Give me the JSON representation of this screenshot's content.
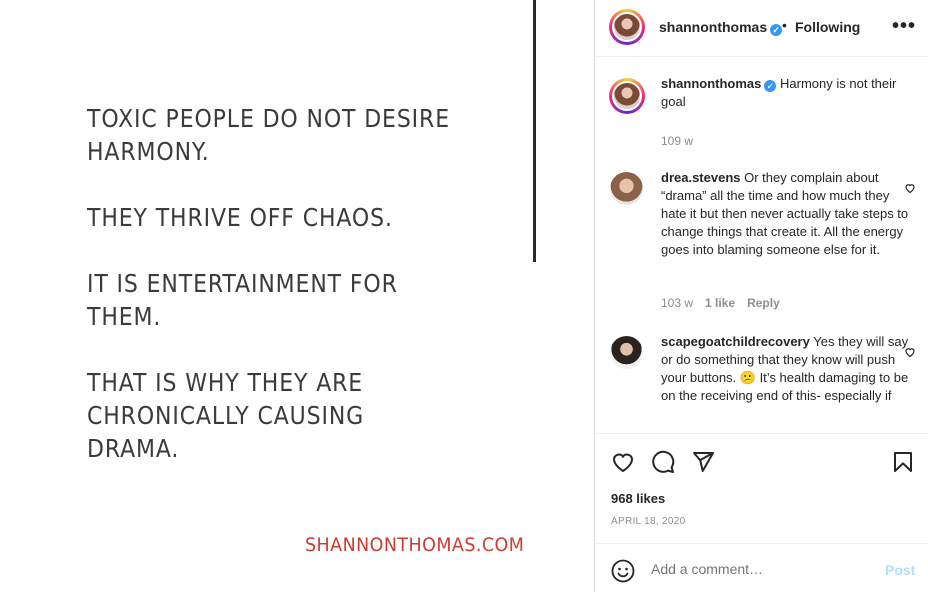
{
  "post_image": {
    "quote_lines": [
      "TOXIC PEOPLE DO NOT DESIRE\nHARMONY.",
      "THEY THRIVE OFF CHAOS.",
      "IT IS ENTERTAINMENT FOR\nTHEM.",
      "THAT IS WHY THEY ARE\nCHRONICALLY CAUSING\nDRAMA."
    ],
    "website": "SHANNONTHOMAS.COM",
    "website_color": "#cc3b2f"
  },
  "header": {
    "username": "shannonthomas",
    "verified_icon": "verified-badge-icon",
    "separator": "•",
    "follow_state": "Following",
    "more_icon": "more-options-icon"
  },
  "caption": {
    "username": "shannonthomas",
    "text": "Harmony is not their goal",
    "age": "109 w"
  },
  "comments": [
    {
      "username": "drea.stevens",
      "text": "Or they complain about “drama” all the time and how much they hate it but then never actually take steps to change things that create it. All the energy goes into blaming someone else for it.",
      "age": "103 w",
      "likes": "1 like",
      "reply": "Reply"
    },
    {
      "username": "scapegoatchildrecovery",
      "text": "Yes they will say or do something that they know will push your buttons. 😕 It’s health damaging to be on the receiving end of this- especially if"
    }
  ],
  "actions": {
    "likes": "968 likes",
    "date": "APRIL 18, 2020"
  },
  "add_comment": {
    "placeholder": "Add a comment…",
    "post_label": "Post",
    "accent_disabled": "#b2dffc"
  }
}
